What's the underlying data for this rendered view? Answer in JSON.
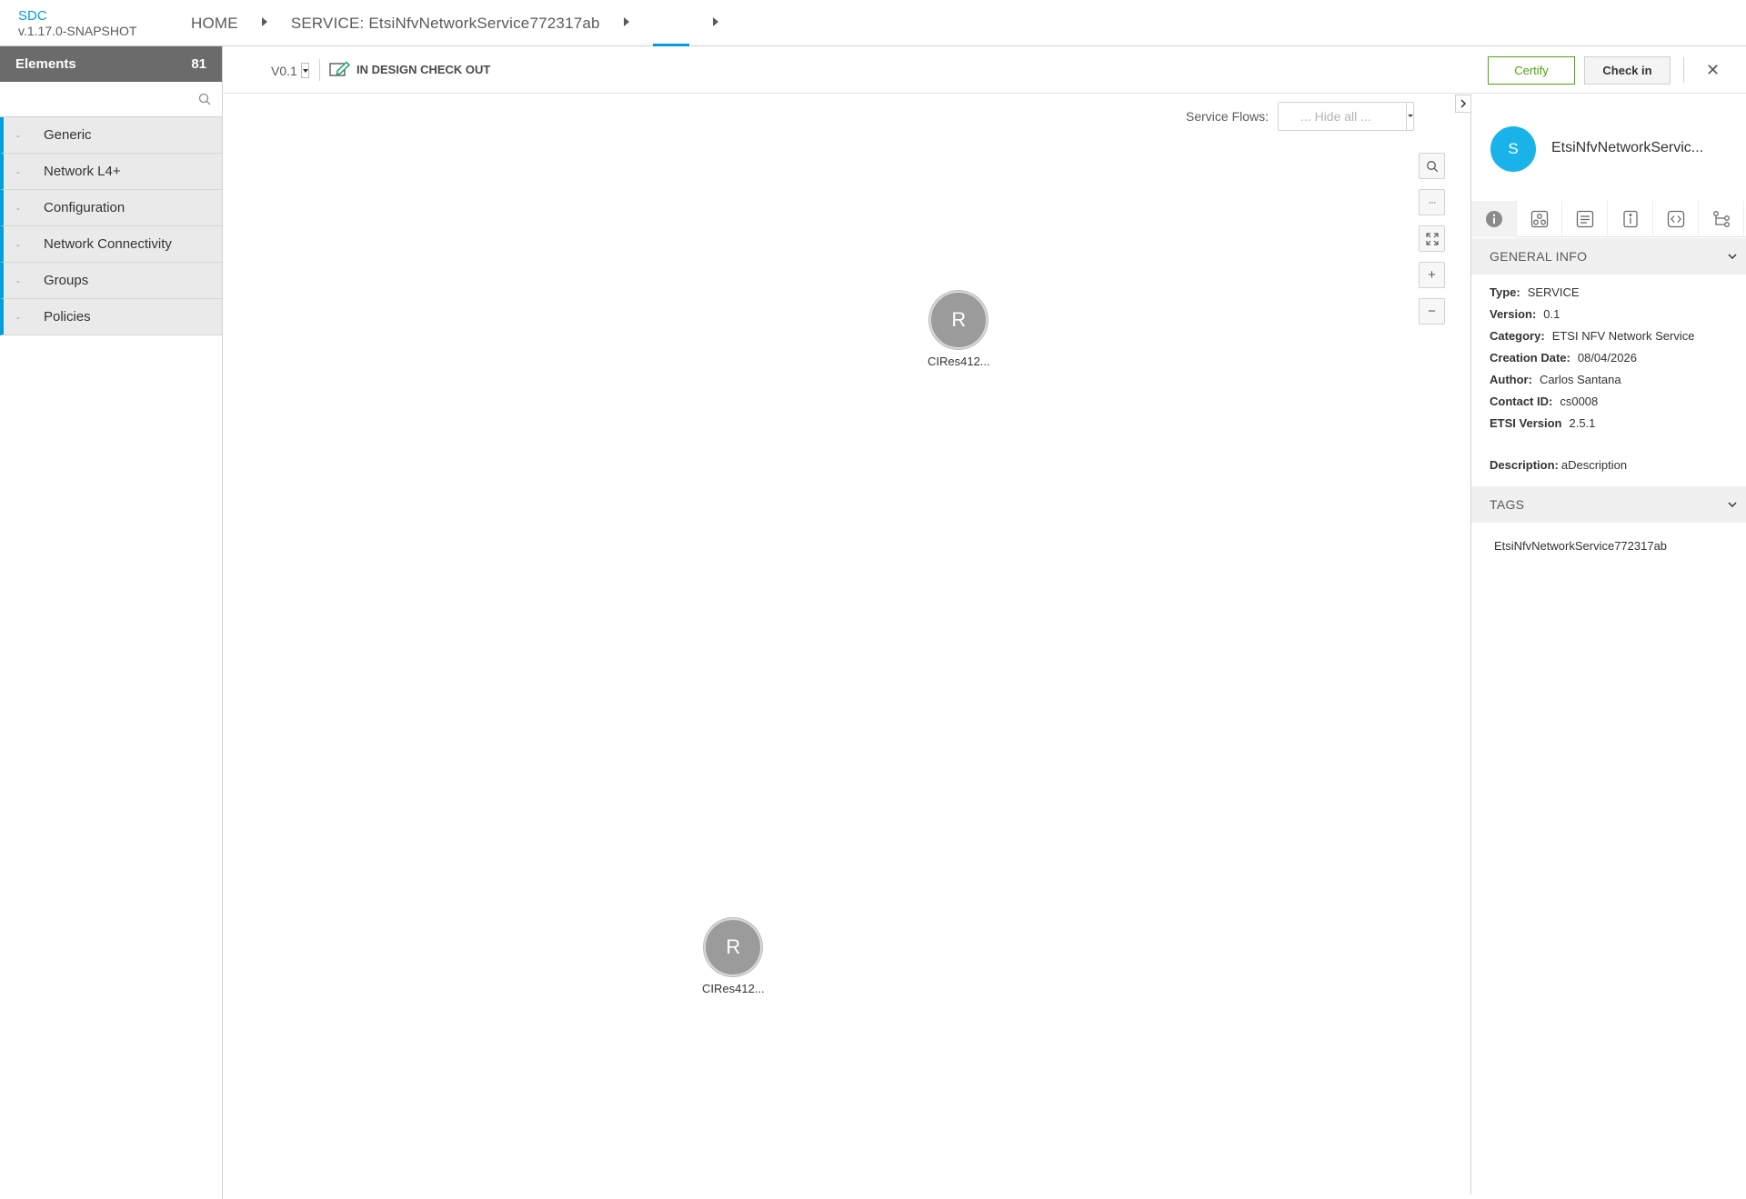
{
  "header": {
    "brand_name": "SDC",
    "brand_version": "v.1.17.0-SNAPSHOT",
    "breadcrumbs": [
      "HOME",
      "SERVICE: EtsiNfvNetworkService772317ab"
    ]
  },
  "palette": {
    "title": "Elements",
    "count": "81",
    "search_placeholder": "",
    "items": [
      {
        "dash": "-",
        "label": "Generic"
      },
      {
        "dash": "-",
        "label": "Network L4+"
      },
      {
        "dash": "-",
        "label": "Configuration"
      },
      {
        "dash": "-",
        "label": "Network Connectivity"
      },
      {
        "dash": "-",
        "label": "Groups"
      },
      {
        "dash": "-",
        "label": "Policies"
      }
    ]
  },
  "toolbar": {
    "version": "V0.1",
    "status": "IN DESIGN CHECK OUT",
    "certify_label": "Certify",
    "checkin_label": "Check in",
    "close_symbol": "✕"
  },
  "canvas": {
    "service_flows_label": "Service Flows:",
    "service_flows_value": "... Hide all ...",
    "zoom_tools": {
      "search": "search-icon",
      "more": "···",
      "fit": "expand-icon",
      "zoom_in": "+",
      "zoom_out": "−"
    },
    "nodes": [
      {
        "letter": "R",
        "label": "CIRes412..."
      },
      {
        "letter": "R",
        "label": "CIRes412..."
      }
    ]
  },
  "right_panel": {
    "avatar_letter": "S",
    "title": "EtsiNfvNetworkServic...",
    "tabs": [
      "info-icon",
      "composition-icon",
      "notes-icon",
      "details-icon",
      "code-icon",
      "flow-icon"
    ],
    "general_info": {
      "title": "GENERAL INFO",
      "rows": [
        {
          "key": "Type:",
          "value": "SERVICE"
        },
        {
          "key": "Version:",
          "value": "0.1"
        },
        {
          "key": "Category:",
          "value": "ETSI NFV Network Service"
        },
        {
          "key": "Creation Date:",
          "value": "08/04/2026"
        },
        {
          "key": "Author:",
          "value": "Carlos Santana"
        },
        {
          "key": "Contact ID:",
          "value": "cs0008"
        },
        {
          "key": "ETSI Version",
          "value": "2.5.1"
        }
      ],
      "description_key": "Description:",
      "description_value": "aDescription"
    },
    "tags": {
      "title": "TAGS",
      "values": [
        "EtsiNfvNetworkService772317ab"
      ]
    }
  },
  "colors": {
    "accent": "#009fdb",
    "certify": "#4ca90c",
    "palette_header": "#6b6b6b",
    "node": "#9b9b9b",
    "avatar": "#19b3ea"
  }
}
